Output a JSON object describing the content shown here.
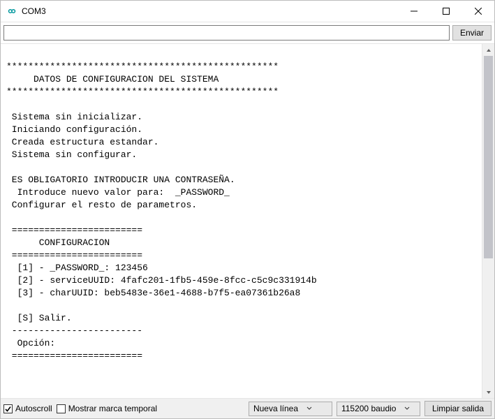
{
  "window": {
    "title": "COM3"
  },
  "input": {
    "value": "",
    "placeholder": ""
  },
  "buttons": {
    "send": "Enviar",
    "clear": "Limpiar salida"
  },
  "checkboxes": {
    "autoscroll": {
      "label": "Autoscroll",
      "checked": true
    },
    "timestamp": {
      "label": "Mostrar marca temporal",
      "checked": false
    }
  },
  "selects": {
    "line_ending": {
      "value": "Nueva línea"
    },
    "baud": {
      "value": "115200 baudio"
    }
  },
  "output_text": "\n**************************************************\n     DATOS DE CONFIGURACION DEL SISTEMA\n**************************************************\n\n Sistema sin inicializar.\n Iniciando configuración.\n Creada estructura estandar.\n Sistema sin configurar.\n\n ES OBLIGATORIO INTRODUCIR UNA CONTRASEÑA.\n  Introduce nuevo valor para:  _PASSWORD_\n Configurar el resto de parametros.\n\n ========================\n      CONFIGURACION\n ========================\n  [1] - _PASSWORD_: 123456\n  [2] - serviceUUID: 4fafc201-1fb5-459e-8fcc-c5c9c331914b\n  [3] - charUUID: beb5483e-36e1-4688-b7f5-ea07361b26a8\n\n  [S] Salir.\n ------------------------\n  Opción:\n ========================"
}
